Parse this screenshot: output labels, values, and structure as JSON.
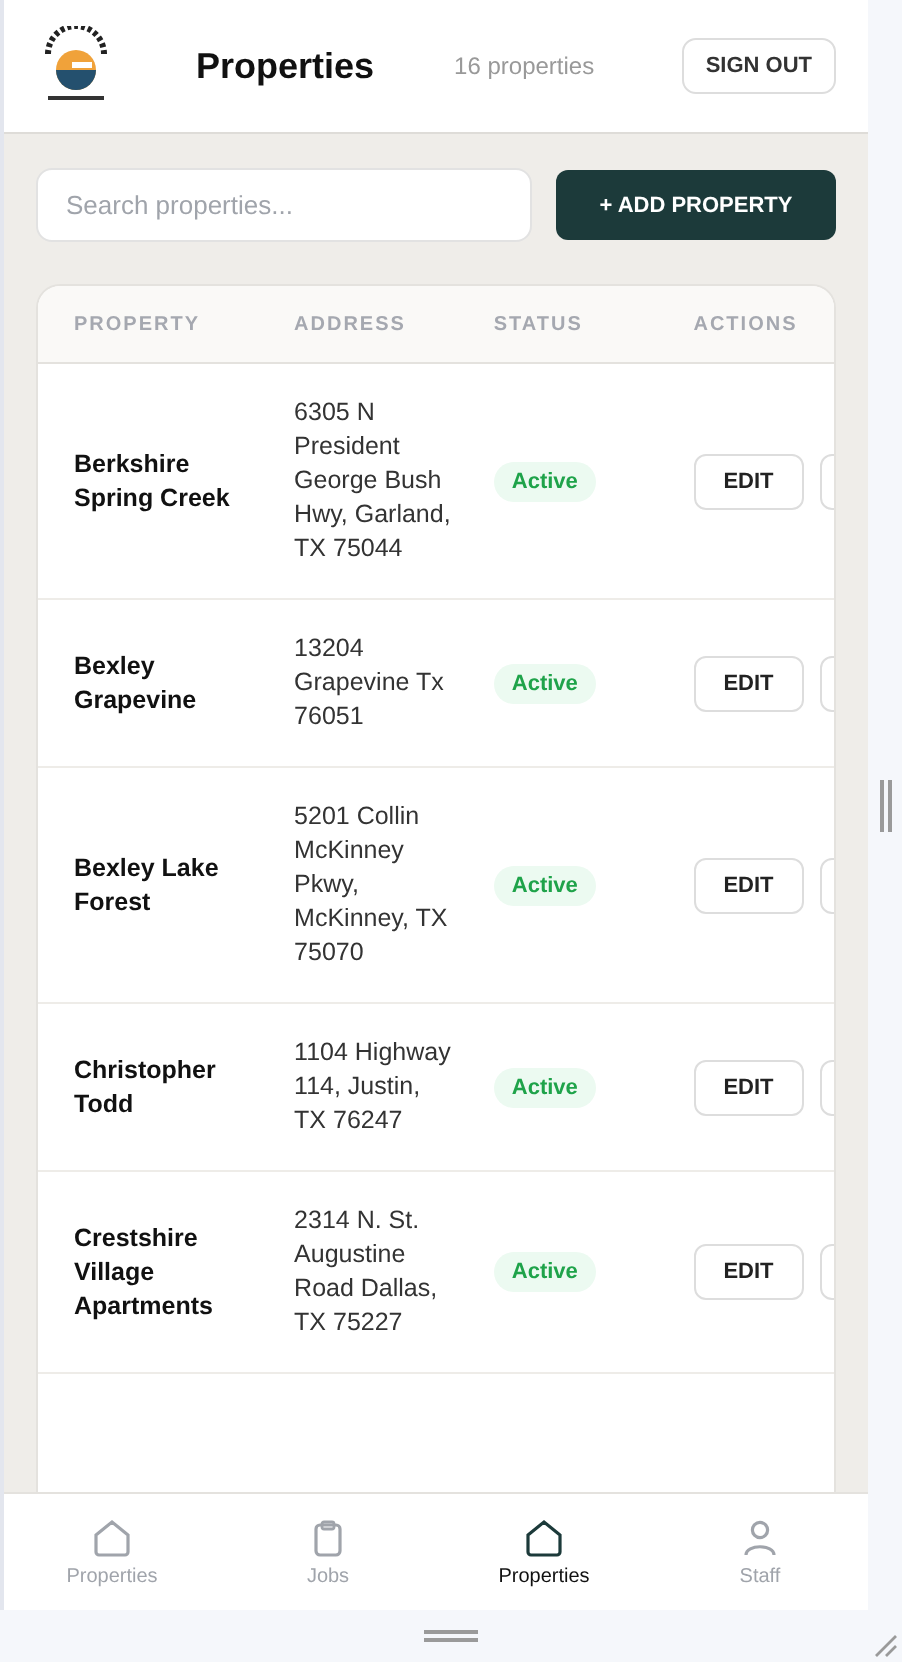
{
  "header": {
    "title": "Properties",
    "count": "16 properties",
    "sign_out": "SIGN OUT"
  },
  "toolbar": {
    "search": {
      "placeholder": "Search properties..."
    },
    "add_button": "+ ADD PROPERTY"
  },
  "table": {
    "columns": [
      "PROPERTY",
      "ADDRESS",
      "STATUS",
      "ACTIONS"
    ],
    "rows": [
      {
        "name": "Berkshire Spring Creek",
        "address": "6305 N President George Bush Hwy, Garland, TX 75044",
        "status": "Active",
        "edit": "EDIT"
      },
      {
        "name": "Bexley Grapevine",
        "address": "13204 Grapevine Tx 76051",
        "status": "Active",
        "edit": "EDIT"
      },
      {
        "name": "Bexley Lake Forest",
        "address": "5201 Collin McKinney Pkwy, McKinney, TX 75070",
        "status": "Active",
        "edit": "EDIT"
      },
      {
        "name": "Christopher Todd",
        "address": "1104 Highway 114, Justin, TX 76247",
        "status": "Active",
        "edit": "EDIT"
      },
      {
        "name": "Crestshire Village Apartments",
        "address": "2314 N. St. Augustine Road Dallas, TX 75227",
        "status": "Active",
        "edit": "EDIT"
      }
    ]
  },
  "nav": [
    {
      "label": "Properties",
      "kind": "home",
      "selected": false
    },
    {
      "label": "Jobs",
      "kind": "clipboard",
      "selected": false
    },
    {
      "label": "Properties",
      "kind": "home",
      "selected": true
    },
    {
      "label": "Staff",
      "kind": "person",
      "selected": false
    }
  ]
}
